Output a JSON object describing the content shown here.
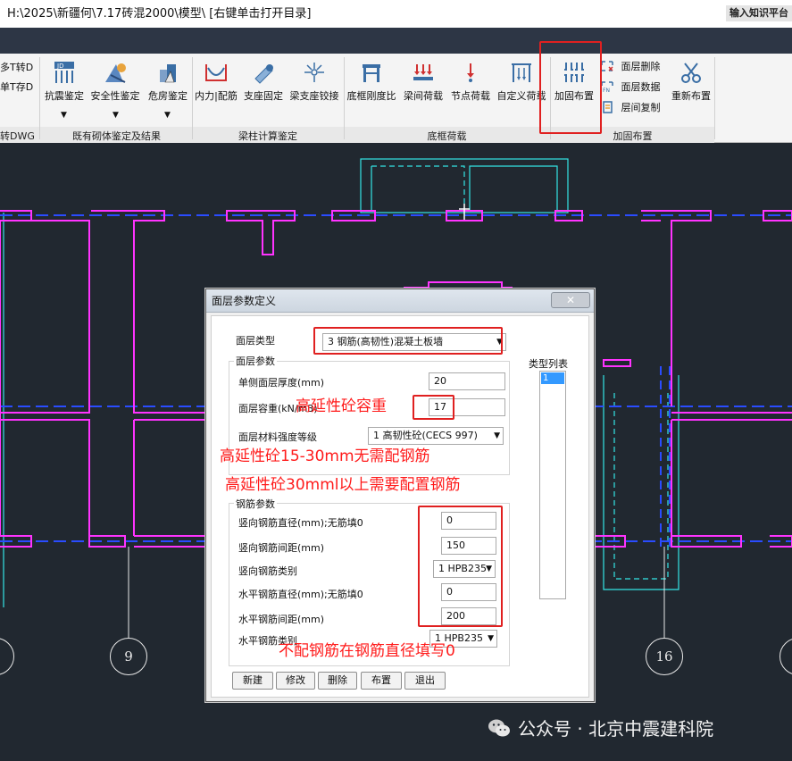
{
  "window": {
    "title": "H:\\2025\\新疆何\\7.17砖混2000\\模型\\ [右键单击打开目录]",
    "search_placeholder": "输入知识平台"
  },
  "ribbon": {
    "left_partial": {
      "item1": "多T转D",
      "item2": "单T存D",
      "group": "转DWG"
    },
    "groups": {
      "masonry": "既有砌体鉴定及结果",
      "beam_column": "梁柱计算鉴定",
      "base_frame": "底框荷载",
      "reinforce": "加固布置"
    },
    "buttons": {
      "seismic": "抗震鉴定",
      "safety": "安全性鉴定",
      "danger": "危房鉴定",
      "internal_force": "内力|配筋",
      "support_fix": "支座固定",
      "support_hinge": "梁支座铰接",
      "frame_stiffness": "底框刚度比",
      "beam_load": "梁间荷载",
      "node_load": "节点荷载",
      "custom_load": "自定义荷载",
      "reinforce_layout": "加固布置",
      "layer_delete": "面层删除",
      "layer_data": "面层数据",
      "layer_copy": "层间复制",
      "relayout": "重新布置"
    }
  },
  "dialog": {
    "title": "面层参数定义",
    "close_label": "✕",
    "layer_type_label": "面层类型",
    "layer_type_value": "3 钢筋(高韧性)混凝土板墙",
    "layer_params_legend": "面层参数",
    "thickness_label": "单侧面层厚度(mm)",
    "thickness_value": "20",
    "density_label": "面层容重(kN/m3)",
    "density_value": "17",
    "strength_label": "面层材料强度等级",
    "strength_value": "1 高韧性砼(CECS 997)",
    "type_list_label": "类型列表",
    "type_list_items": [
      "1"
    ],
    "rebar_legend": "钢筋参数",
    "v_dia_label": "竖向钢筋直径(mm);无筋填0",
    "v_dia_value": "0",
    "v_spacing_label": "竖向钢筋间距(mm)",
    "v_spacing_value": "150",
    "v_type_label": "竖向钢筋类别",
    "v_type_value": "1 HPB235",
    "h_dia_label": "水平钢筋直径(mm);无筋填0",
    "h_dia_value": "0",
    "h_spacing_label": "水平钢筋间距(mm)",
    "h_spacing_value": "200",
    "h_type_label": "水平钢筋类别",
    "h_type_value": "1 HPB235",
    "buttons": {
      "new": "新建",
      "modify": "修改",
      "delete": "删除",
      "place": "布置",
      "exit": "退出"
    }
  },
  "annotations": {
    "density_note": "高延性砼容重",
    "note_15_30": "高延性砼15-30mm无需配钢筋",
    "note_30_up": "高延性砼30mml以上需要配置钢筋",
    "note_zero": "不配钢筋在钢筋直径填写0"
  },
  "canvas": {
    "axis_9": "9",
    "axis_16": "16"
  },
  "watermark": "公众号 · 北京中震建科院",
  "colors": {
    "canvas_bg": "#212830",
    "magenta_wall": "#ff33ff",
    "blue_axis": "#2a4cff",
    "cyan_line": "#33e6e6",
    "annotation_red": "#e02020"
  }
}
